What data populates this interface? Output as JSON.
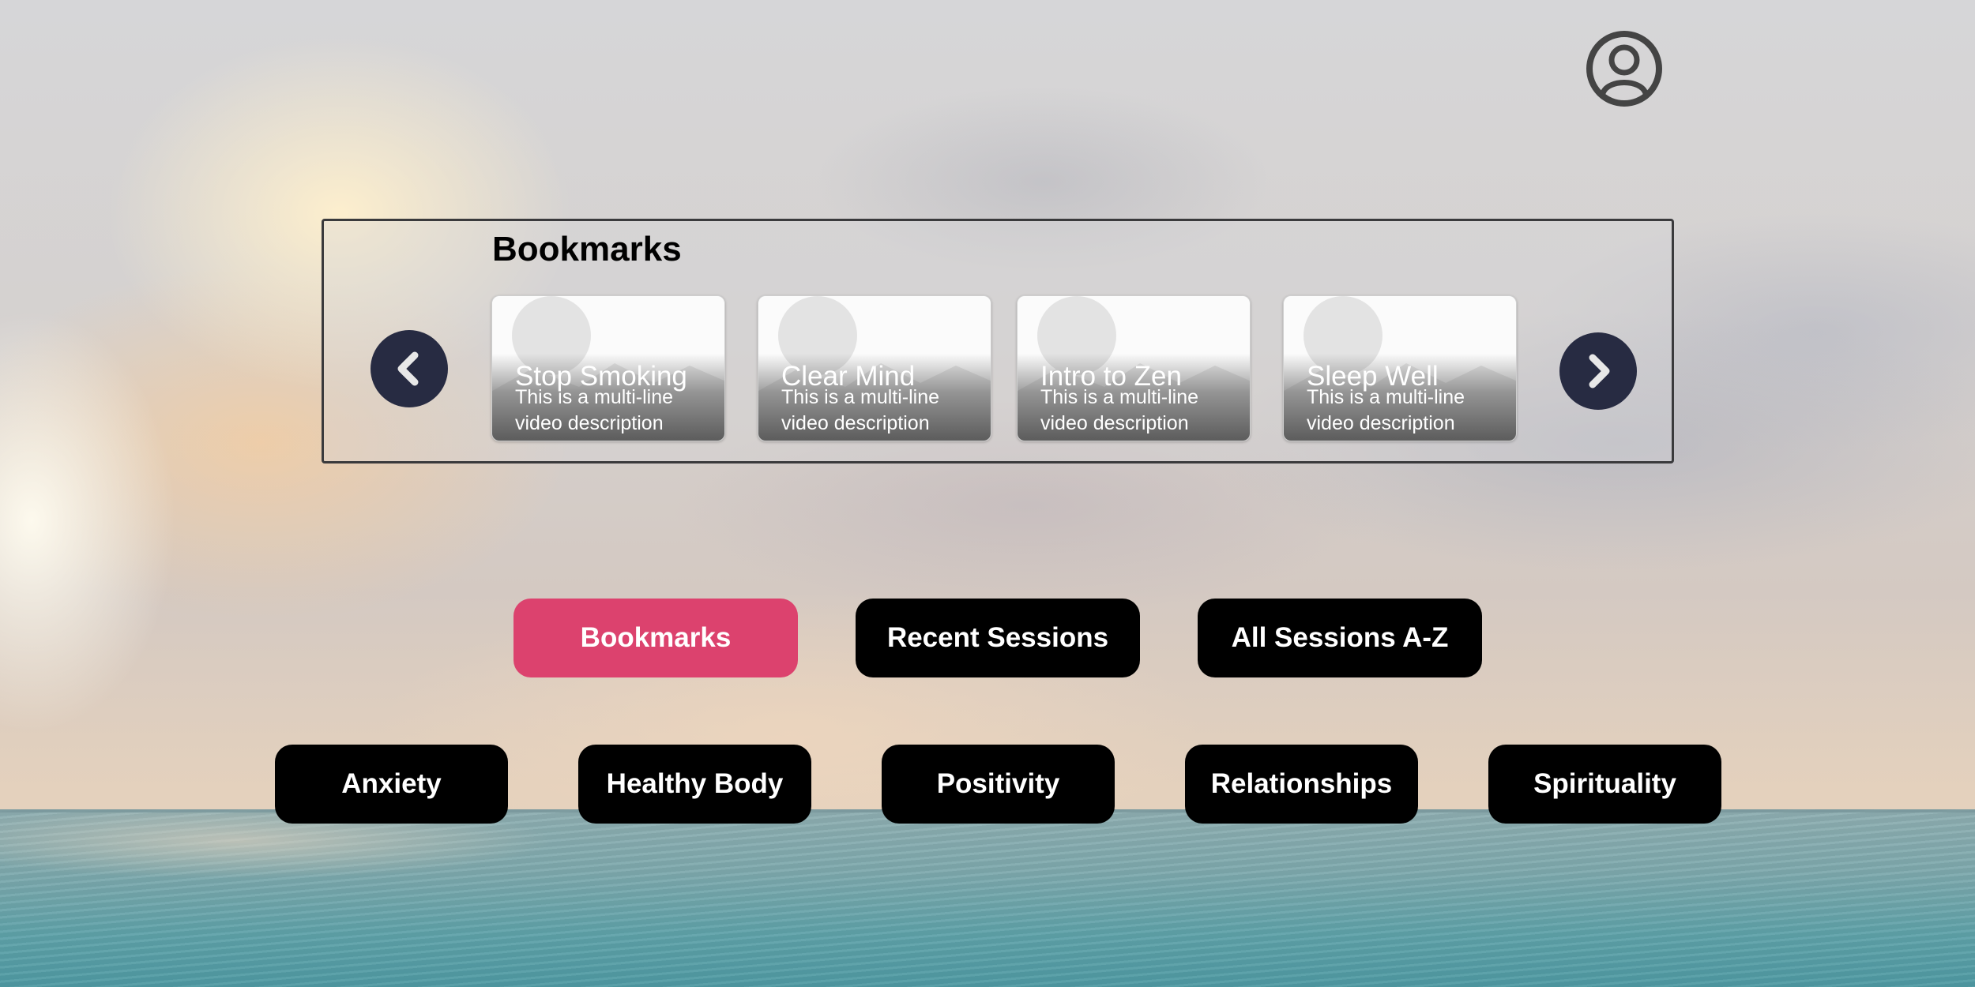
{
  "colors": {
    "accent": "#dc426e",
    "button_bg": "#000000",
    "nav_circle": "#272b42",
    "panel_border": "#3a3a3c",
    "profile_icon": "#444444"
  },
  "header": {
    "profile_icon": "user-circle-icon"
  },
  "bookmarks_panel": {
    "title": "Bookmarks",
    "prev_icon": "chevron-left-icon",
    "next_icon": "chevron-right-icon",
    "cards": [
      {
        "title": "Stop Smoking",
        "description": "This is a multi-line video description"
      },
      {
        "title": "Clear Mind",
        "description": "This is a multi-line video description"
      },
      {
        "title": "Intro to Zen",
        "description": "This is a multi-line video description"
      },
      {
        "title": "Sleep Well",
        "description": "This is a multi-line video description"
      }
    ]
  },
  "tabs": [
    {
      "label": "Bookmarks",
      "active": true
    },
    {
      "label": "Recent Sessions",
      "active": false
    },
    {
      "label": "All Sessions A-Z",
      "active": false
    }
  ],
  "categories": [
    {
      "label": "Anxiety"
    },
    {
      "label": "Healthy Body"
    },
    {
      "label": "Positivity"
    },
    {
      "label": "Relationships"
    },
    {
      "label": "Spirituality"
    }
  ]
}
